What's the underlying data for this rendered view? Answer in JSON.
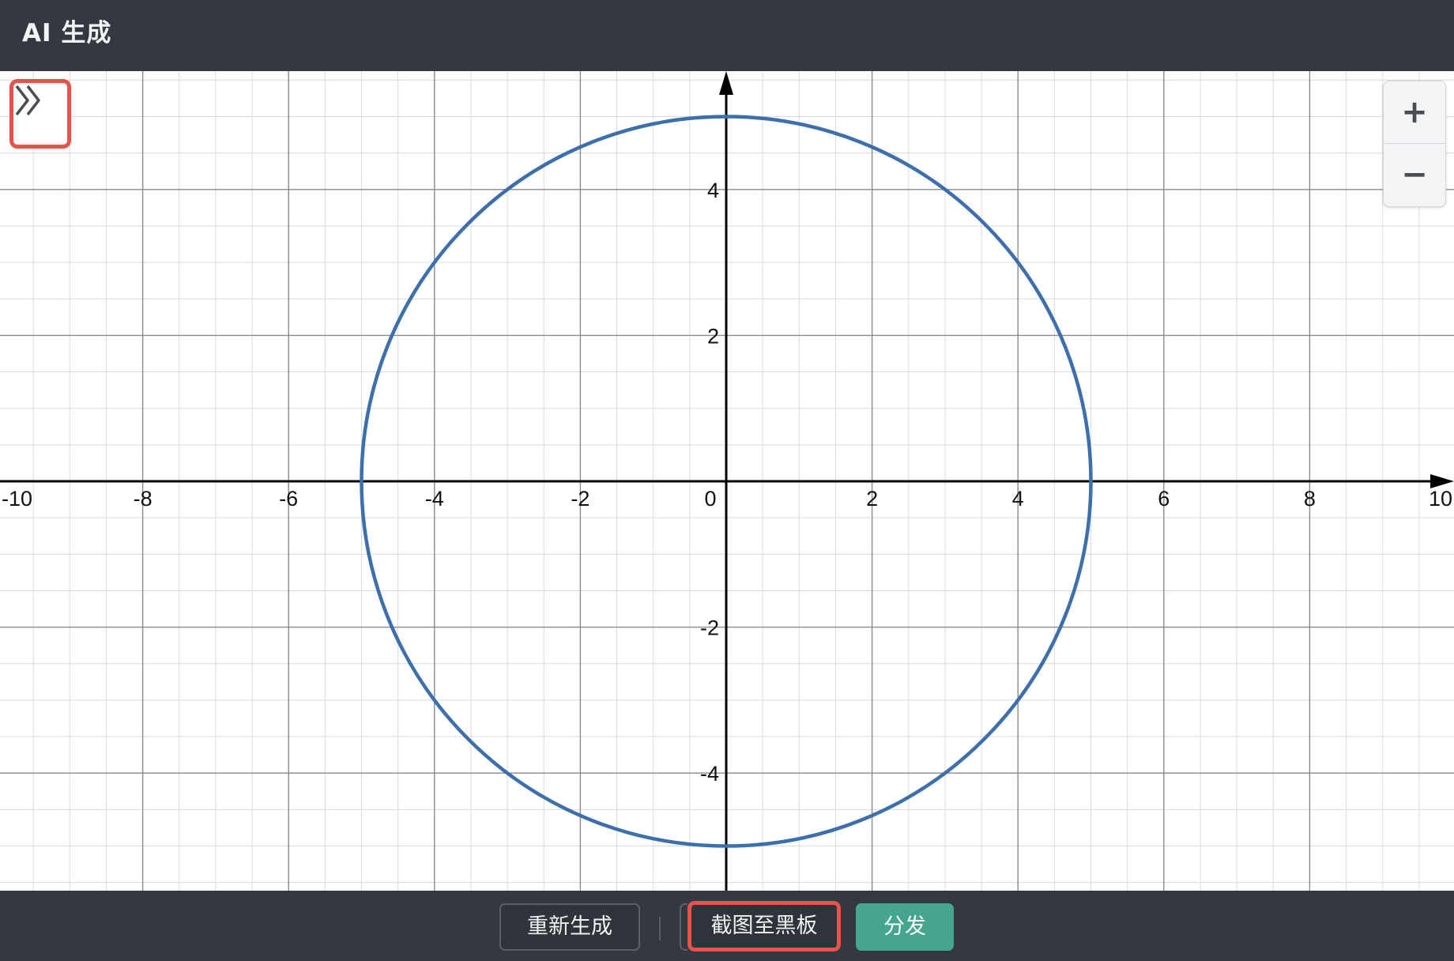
{
  "window": {
    "title": "AI 生成",
    "controls": [
      {
        "name": "refresh-icon"
      },
      {
        "name": "minimize-icon"
      },
      {
        "name": "fullscreen-icon"
      },
      {
        "name": "close-icon"
      }
    ]
  },
  "graph": {
    "expand_icon": "double-chevron-right-icon",
    "zoom_in_label": "+",
    "zoom_out_label": "−",
    "colors": {
      "curve": "#3d6fad",
      "axis": "#000000",
      "major_grid": "#8a8a8a",
      "minor_grid": "#dadada",
      "highlight": "#e5534b"
    }
  },
  "chart_data": {
    "type": "line",
    "title": "",
    "xlabel": "",
    "ylabel": "",
    "xlim": [
      -10,
      10
    ],
    "ylim": [
      -5.6,
      5.6
    ],
    "grid": true,
    "x_ticks": [
      "-10",
      "-8",
      "-6",
      "-4",
      "-2",
      "0",
      "2",
      "4",
      "6",
      "8",
      "10"
    ],
    "y_ticks": [
      "4",
      "2",
      "-2",
      "-4"
    ],
    "series": [
      {
        "center": [
          0,
          0
        ],
        "radius": 5,
        "shape": "circle"
      }
    ]
  },
  "bottom_bar": {
    "regenerate_label": "重新生成",
    "screenshot_label": "截图至黑板",
    "distribute_label": "分发"
  }
}
